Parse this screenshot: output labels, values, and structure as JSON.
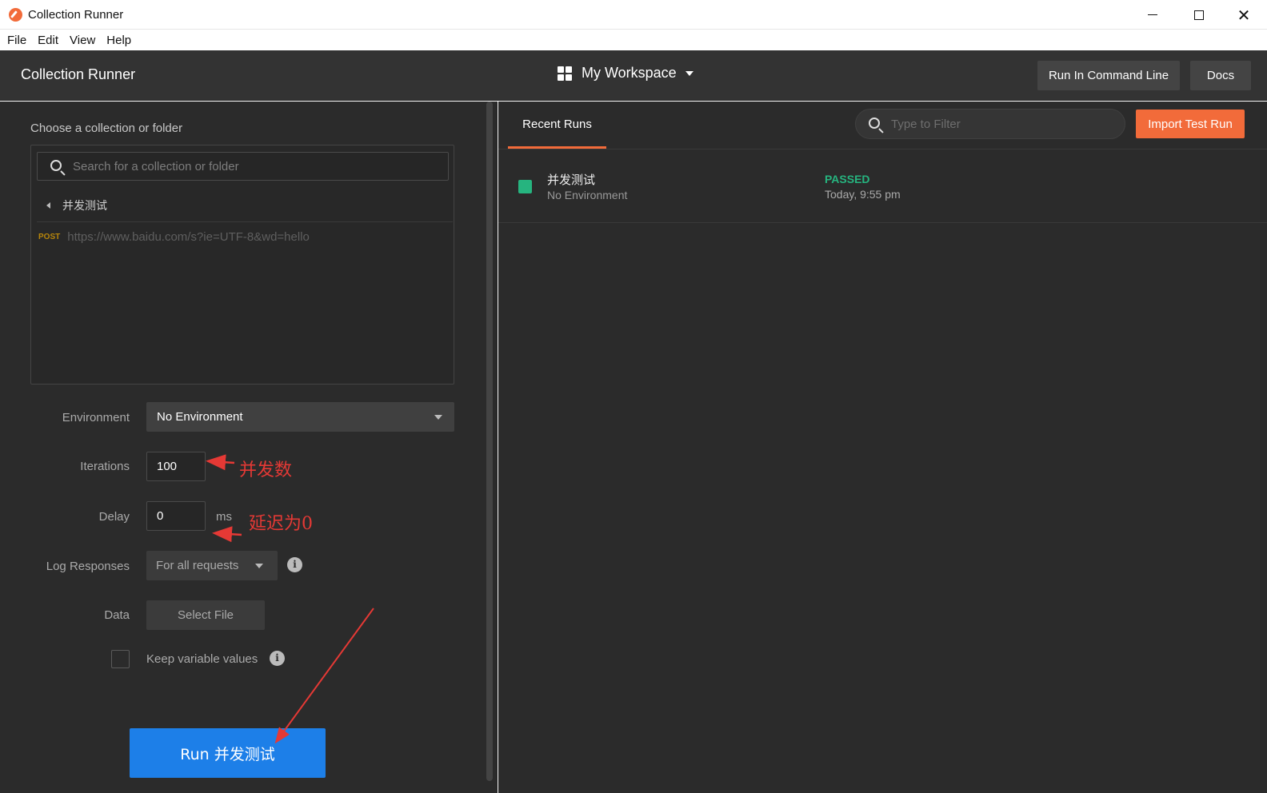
{
  "window": {
    "title": "Collection Runner"
  },
  "menu": [
    "File",
    "Edit",
    "View",
    "Help"
  ],
  "header": {
    "title": "Collection Runner",
    "workspace": "My Workspace",
    "run_cli_label": "Run In Command Line",
    "docs_label": "Docs"
  },
  "left": {
    "choose_label": "Choose a collection or folder",
    "search_placeholder": "Search for a collection or folder",
    "folder_name": "并发测试",
    "request": {
      "method": "POST",
      "url": "https://www.baidu.com/s?ie=UTF-8&wd=hello"
    },
    "environment": {
      "label": "Environment",
      "value": "No Environment"
    },
    "iterations": {
      "label": "Iterations",
      "value": "100"
    },
    "delay": {
      "label": "Delay",
      "value": "0",
      "unit": "ms"
    },
    "log_responses": {
      "label": "Log Responses",
      "value": "For all requests"
    },
    "data": {
      "label": "Data",
      "button": "Select File"
    },
    "keep_variables": {
      "label": "Keep variable values",
      "checked": false
    },
    "run_button": "Run 并发测试"
  },
  "annotations": {
    "iterations_note": "并发数",
    "delay_note": "延迟为0"
  },
  "right": {
    "tab": "Recent Runs",
    "filter_placeholder": "Type to Filter",
    "import_label": "Import Test Run",
    "runs": [
      {
        "name": "并发测试",
        "environment": "No Environment",
        "status": "PASSED",
        "time": "Today, 9:55 pm"
      }
    ]
  },
  "colors": {
    "accent": "#f26b3a",
    "run_button": "#1d7fe8",
    "passed": "#26b47f",
    "annotation": "#e53935"
  }
}
